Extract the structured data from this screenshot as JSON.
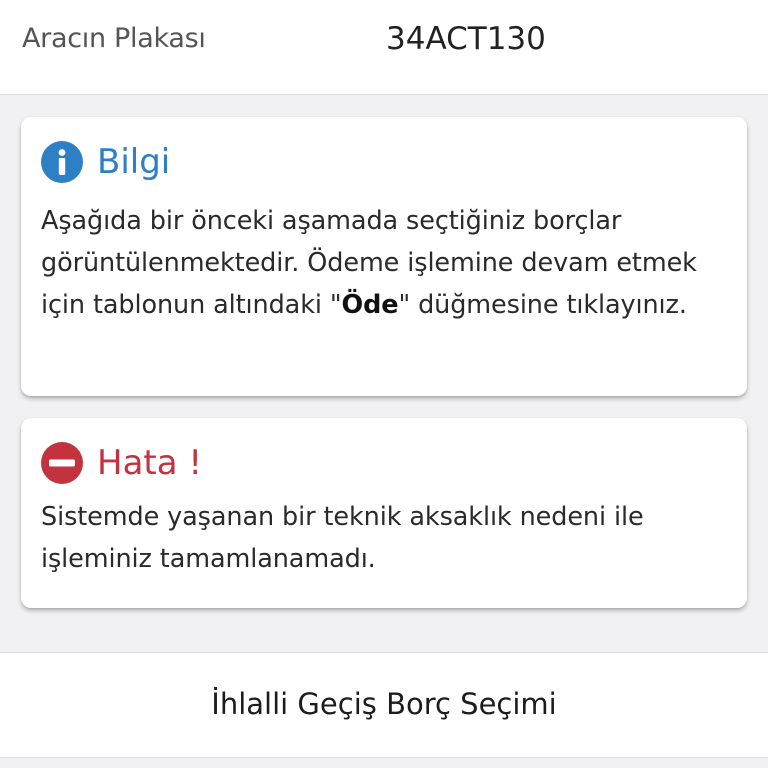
{
  "plate": {
    "label": "Aracın Plakası",
    "value": "34ACT130"
  },
  "info_card": {
    "icon": "info-icon",
    "title": "Bilgi",
    "body_part1": "Aşağıda bir önceki aşamada seçtiğiniz borçlar görüntülenmektedir. Ödeme işlemine devam etmek için tablonun altındaki \"",
    "body_bold": "Öde",
    "body_part2": "\" düğmesine tıklayınız.",
    "color": "#2d7fc6"
  },
  "error_card": {
    "icon": "error-icon",
    "title": "Hata !",
    "body": "Sistemde yaşanan bir teknik aksaklık nedeni ile işleminiz tamamlanamadı.",
    "color": "#c2333d"
  },
  "section": {
    "title": "İhlalli Geçiş Borç Seçimi"
  }
}
